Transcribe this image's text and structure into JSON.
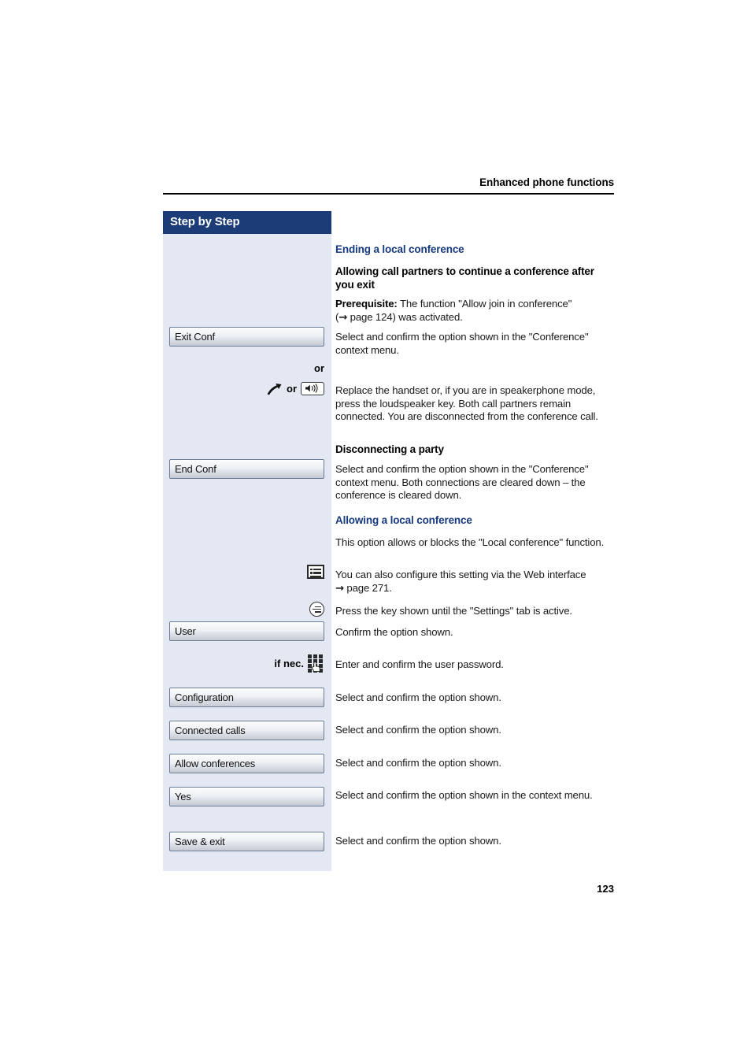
{
  "header": {
    "running_title": "Enhanced phone functions",
    "page_number": "123"
  },
  "sidebar": {
    "title": "Step by Step",
    "items": [
      {
        "type": "softkey",
        "label": "Exit Conf"
      },
      {
        "type": "marker",
        "label": "or"
      },
      {
        "type": "marker",
        "label": "or",
        "icons": [
          "handset-icon",
          "loudspeaker-key-icon"
        ]
      },
      {
        "type": "softkey",
        "label": "End Conf"
      },
      {
        "type": "icon",
        "label": "",
        "icon": "web-interface-icon"
      },
      {
        "type": "icon",
        "label": "",
        "icon": "settings-key-icon"
      },
      {
        "type": "softkey",
        "label": "User"
      },
      {
        "type": "marker",
        "label": "if nec.",
        "icon": "keypad-icon"
      },
      {
        "type": "softkey",
        "label": "Configuration"
      },
      {
        "type": "softkey",
        "label": "Connected calls"
      },
      {
        "type": "softkey",
        "label": "Allow conferences"
      },
      {
        "type": "softkey",
        "label": "Yes"
      },
      {
        "type": "softkey",
        "label": "Save & exit"
      }
    ]
  },
  "content": {
    "heading_ending": "Ending a local conference",
    "subheading_allowing": "Allowing call partners to continue a conference after you exit",
    "prerequisite_label": "Prerequisite:",
    "prerequisite_text": " The function \"Allow join in conference\"",
    "prerequisite_text2_prefix": "(",
    "prerequisite_arrow": "→",
    "prerequisite_text2": " page 124) was activated.",
    "para_exit_conf": "Select and confirm the option shown in the \"Conference\" context menu.",
    "para_handset": "Replace the handset or, if you are in speakerphone mode, press the loudspeaker key. Both call partners remain connected. You are disconnected from the conference call.",
    "subheading_disconnect": "Disconnecting a party",
    "para_end_conf": "Select and confirm the option shown in the \"Conference\" context menu. Both connections are cleared down – the conference is cleared down.",
    "heading_allowing_local": "Allowing a local conference",
    "para_option_allows": "This option allows or blocks the \"Local conference\" function.",
    "para_webiface": "You can also configure this setting via the Web interface",
    "para_webiface_arrow": "→",
    "para_webiface_page": " page 271.",
    "para_press_key": "Press the key shown until the \"Settings\" tab is active.",
    "para_confirm_option": "Confirm the option shown.",
    "para_enter_password": "Enter and confirm the user password.",
    "para_select_confirm_1": "Select and confirm the option shown.",
    "para_select_confirm_2": "Select and confirm the option shown.",
    "para_select_confirm_3": "Select and confirm the option shown.",
    "para_select_confirm_context": "Select and confirm the option shown in the context menu.",
    "para_select_confirm_4": "Select and confirm the option shown."
  },
  "colors": {
    "header_bar": "#1b3c77",
    "sidebar_bg": "#e3e8f2",
    "heading_blue": "#17397e"
  }
}
